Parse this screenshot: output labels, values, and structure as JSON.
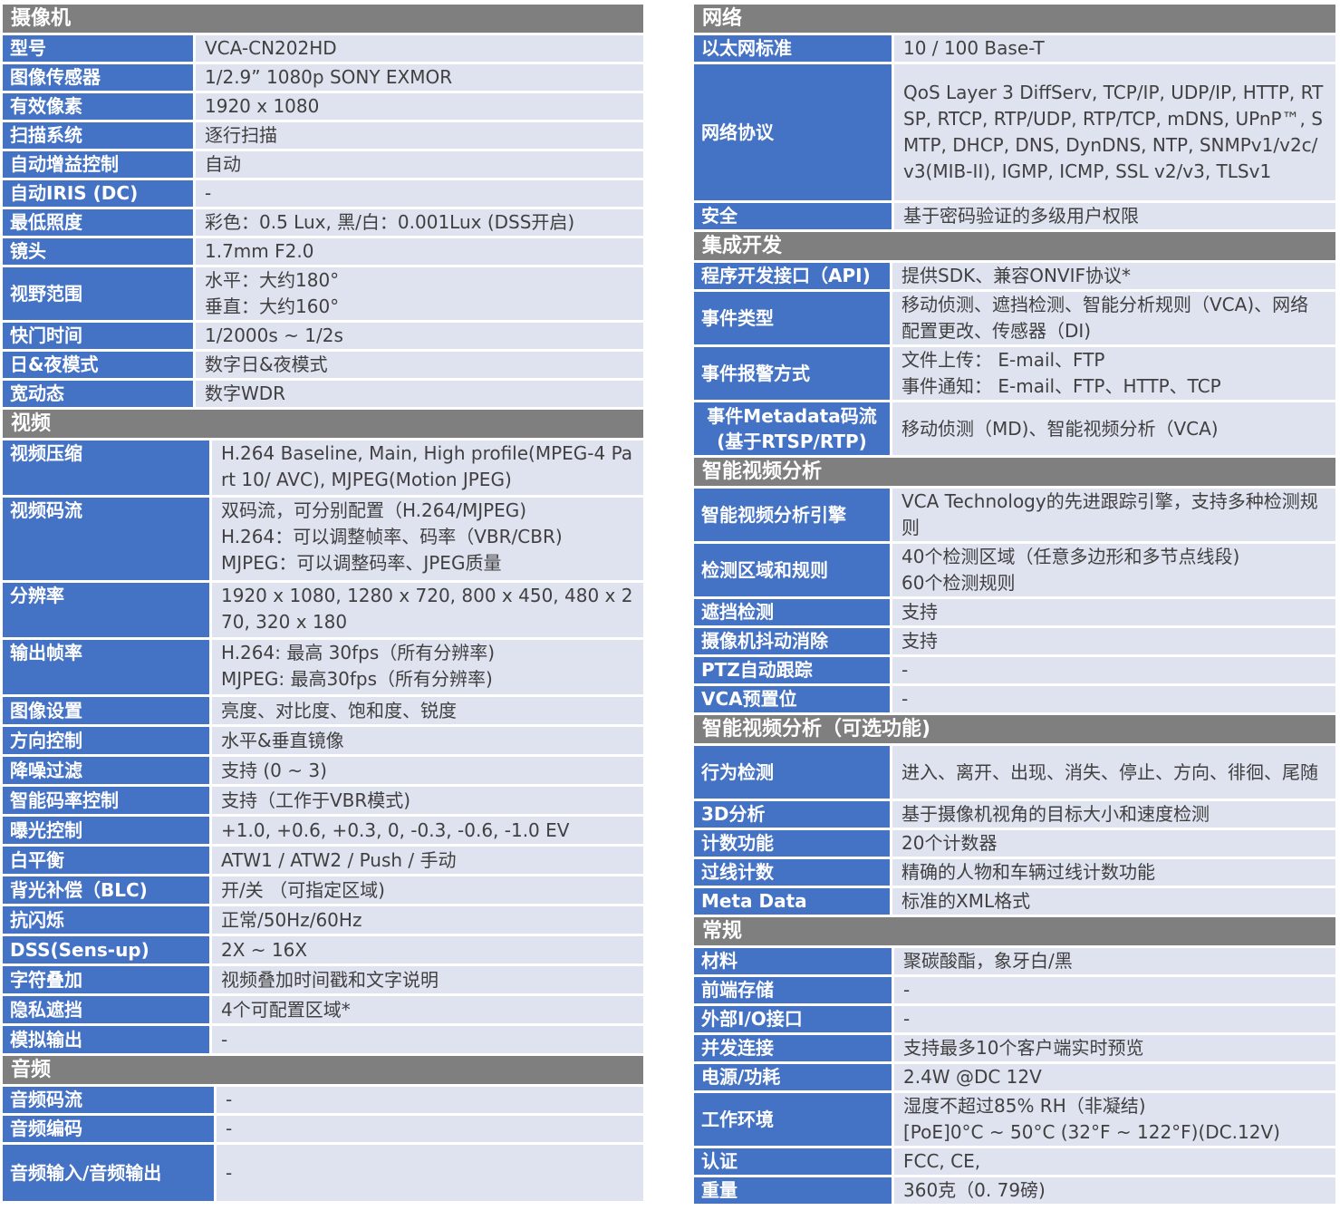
{
  "left": [
    {
      "title": "摄像机",
      "label_width": 210,
      "rows": [
        {
          "label": "型号",
          "value": "VCA-CN202HD",
          "h": 29
        },
        {
          "label": "图像传感器",
          "value": "1/2.9” 1080p SONY EXMOR",
          "h": 29
        },
        {
          "label": "有效像素",
          "value": "1920 x 1080",
          "h": 29
        },
        {
          "label": "扫描系统",
          "value": "逐行扫描",
          "h": 29
        },
        {
          "label": "自动增益控制",
          "value": "自动",
          "h": 29
        },
        {
          "label": "自动IRIS (DC)",
          "value": "-",
          "h": 29
        },
        {
          "label": "最低照度",
          "value": "彩色：0.5 Lux, 黑/白：0.001Lux (DSS开启)",
          "h": 29
        },
        {
          "label": "镜头",
          "value": "1.7mm F2.0",
          "h": 29
        },
        {
          "label": "视野范围",
          "value": "水平：大约180°\n垂直：大约160°",
          "h": 58
        },
        {
          "label": "快门时间",
          "value": "1/2000s ~ 1/2s",
          "h": 29
        },
        {
          "label": "日&夜模式",
          "value": "数字日&夜模式",
          "h": 29
        },
        {
          "label": "宽动态",
          "value": "数字WDR",
          "h": 29
        }
      ]
    },
    {
      "title": "视频",
      "label_width": 228,
      "rows": [
        {
          "label": "视频压缩",
          "value": "H.264 Baseline, Main, High profile(MPEG-4 Part 10/ AVC), MJPEG(Motion JPEG)",
          "h": 60,
          "top": true
        },
        {
          "label": "视频码流",
          "value": "双码流，可分别配置（H.264/MJPEG)\nH.264：可以调整帧率、码率（VBR/CBR)\nMJPEG：可以调整码率、JPEG质量",
          "h": 91,
          "top": true
        },
        {
          "label": "分辨率",
          "value": "1920 x 1080, 1280 x 720, 800 x 450, 480 x 270, 320 x 180",
          "h": 60,
          "top": true
        },
        {
          "label": "输出帧率",
          "value": "H.264: 最高 30fps（所有分辨率)\nMJPEG: 最高30fps（所有分辨率)",
          "h": 60,
          "top": true
        },
        {
          "label": "图像设置",
          "value": "亮度、对比度、饱和度、锐度",
          "h": 30
        },
        {
          "label": "方向控制",
          "value": "水平&垂直镜像",
          "h": 30
        },
        {
          "label": "降噪过滤",
          "value": "支持 (0 ~ 3)",
          "h": 30
        },
        {
          "label": "智能码率控制",
          "value": "支持（工作于VBR模式)",
          "h": 30
        },
        {
          "label": "曝光控制",
          "value": "+1.0, +0.6, +0.3, 0, -0.3, -0.6, -1.0 EV",
          "h": 30
        },
        {
          "label": "白平衡",
          "value": "ATW1 / ATW2 / Push / 手动",
          "h": 30
        },
        {
          "label": "背光补偿（BLC)",
          "value": "开/关 （可指定区域)",
          "h": 30
        },
        {
          "label": "抗闪烁",
          "value": "正常/50Hz/60Hz",
          "h": 30
        },
        {
          "label": "DSS(Sens-up)",
          "value": "2X ~ 16X",
          "h": 30
        },
        {
          "label": "字符叠加",
          "value": "视频叠加时间戳和文字说明",
          "h": 30
        },
        {
          "label": "隐私遮挡",
          "value": "4个可配置区域*",
          "h": 30
        },
        {
          "label": "模拟输出",
          "value": "-",
          "h": 30
        }
      ]
    },
    {
      "title": "音频",
      "label_width": 233,
      "rows": [
        {
          "label": "音频码流",
          "value": "-",
          "h": 29
        },
        {
          "label": "音频编码",
          "value": "-",
          "h": 29
        },
        {
          "label": "音频输入/音频输出",
          "value": "-",
          "h": 62
        }
      ]
    }
  ],
  "right": [
    {
      "title": "网络",
      "label_width": 218,
      "rows": [
        {
          "label": "以太网标准",
          "value": "10 / 100 Base-T",
          "h": 29
        },
        {
          "label": "网络协议",
          "value": "QoS Layer 3 DiffServ, TCP/IP, UDP/IP, HTTP, RTSP, RTCP, RTP/UDP, RTP/TCP, mDNS, UPnP™, SMTP, DHCP, DNS, DynDNS, NTP, SNMPv1/v2c/v3(MIB-II), IGMP, ICMP, SSL v2/v3, TLSv1",
          "h": 150
        },
        {
          "label": "安全",
          "value": "基于密码验证的多级用户权限",
          "h": 29
        }
      ]
    },
    {
      "title": "集成开发",
      "label_width": 216,
      "rows": [
        {
          "label": "程序开发接口（API)",
          "value": "提供SDK、兼容ONVIF协议*",
          "h": 29
        },
        {
          "label": "事件类型",
          "value": "移动侦测、遮挡检测、智能分析规则（VCA)、网络配置更改、传感器（DI)",
          "h": 58
        },
        {
          "label": "事件报警方式",
          "value": "文件上传： E-mail、FTP\n事件通知： E-mail、FTP、HTTP、TCP",
          "h": 58
        },
        {
          "label": "事件Metadata码流\n(基于RTSP/RTP)",
          "value": "移动侦测（MD)、智能视频分析（VCA)",
          "h": 58,
          "center": true
        }
      ]
    },
    {
      "title": "智能视频分析",
      "label_width": 216,
      "rows": [
        {
          "label": "智能视频分析引擎",
          "value": "VCA Technology的先进跟踪引擎，支持多种检测规则",
          "h": 58
        },
        {
          "label": "检测区域和规则",
          "value": "40个检测区域（任意多边形和多节点线段)\n60个检测规则",
          "h": 58
        },
        {
          "label": "遮挡检测",
          "value": "支持",
          "h": 29
        },
        {
          "label": "摄像机抖动消除",
          "value": "支持",
          "h": 29
        },
        {
          "label": "PTZ自动跟踪",
          "value": "-",
          "h": 29
        },
        {
          "label": "VCA预置位",
          "value": "-",
          "h": 29
        }
      ]
    },
    {
      "title": "智能视频分析（可选功能)",
      "label_width": 216,
      "rows": [
        {
          "label": "行为检测",
          "value": "进入、离开、出现、消失、停止、方向、徘徊、尾随",
          "h": 58
        },
        {
          "label": "3D分析",
          "value": "基于摄像机视角的目标大小和速度检测",
          "h": 29
        },
        {
          "label": "计数功能",
          "value": "20个计数器",
          "h": 29
        },
        {
          "label": "过线计数",
          "value": "精确的人物和车辆过线计数功能",
          "h": 29
        },
        {
          "label": "Meta Data",
          "value": "标准的XML格式",
          "h": 29
        }
      ]
    },
    {
      "title": "常规",
      "label_width": 218,
      "rows": [
        {
          "label": "材料",
          "value": "聚碳酸酯，象牙白/黑",
          "h": 29
        },
        {
          "label": "前端存储",
          "value": "-",
          "h": 29
        },
        {
          "label": "外部I/O接口",
          "value": "-",
          "h": 29
        },
        {
          "label": "并发连接",
          "value": "支持最多10个客户端实时预览",
          "h": 29
        },
        {
          "label": "电源/功耗",
          "value": "2.4W @DC 12V",
          "h": 29
        },
        {
          "label": "工作环境",
          "value": "湿度不超过85% RH（非凝结)\n[PoE]0°C ~ 50°C (32°F ~ 122°F)(DC.12V)",
          "h": 58
        },
        {
          "label": "认证",
          "value": "FCC, CE,",
          "h": 29
        },
        {
          "label": "重量",
          "value": "360克（0. 79磅)",
          "h": 29
        }
      ]
    }
  ]
}
